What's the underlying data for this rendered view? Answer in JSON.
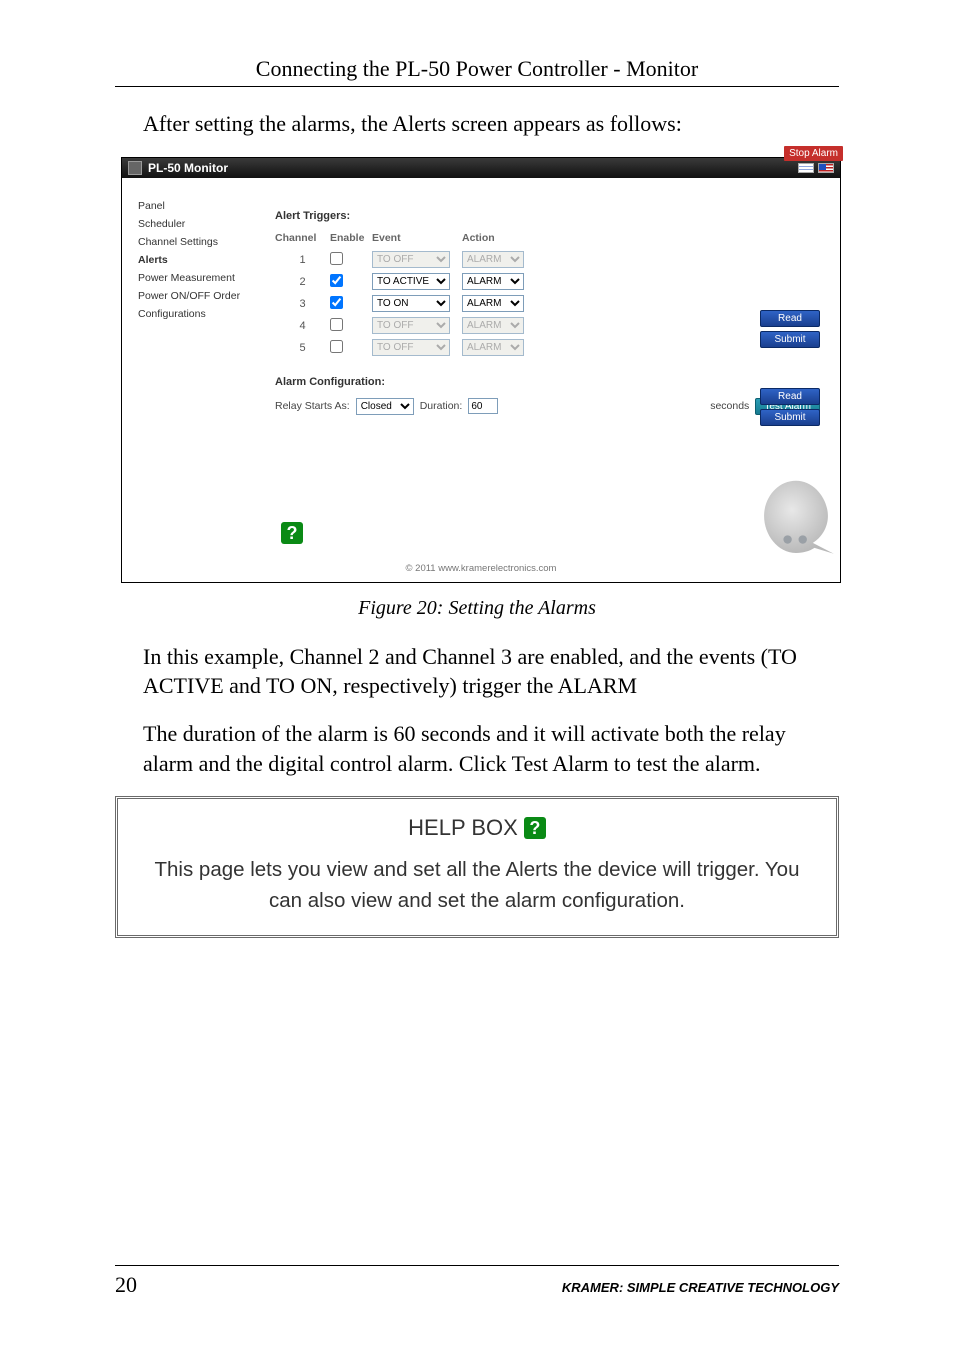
{
  "header": "Connecting the PL-50 Power Controller - Monitor",
  "intro": "After setting the alarms, the Alerts screen appears as follows:",
  "caption": "Figure 20: Setting the Alarms",
  "para1": "In this example, Channel 2 and Channel 3 are enabled, and the events (TO ACTIVE and TO ON, respectively) trigger the ALARM",
  "para2": "The duration of the alarm is 60 seconds and it will activate both the relay alarm and the digital control alarm. Click Test Alarm to test the alarm.",
  "helpbox": {
    "title": "HELP BOX",
    "body": "This page lets you view and set all the Alerts the device will trigger. You can also view and set the alarm configuration."
  },
  "footer": {
    "page": "20",
    "brand": "KRAMER:  SIMPLE CREATIVE TECHNOLOGY"
  },
  "app": {
    "stop_alarm": "Stop Alarm",
    "title": "PL-50 Monitor",
    "nav": {
      "panel": "Panel",
      "scheduler": "Scheduler",
      "channel_settings": "Channel Settings",
      "alerts": "Alerts",
      "power_meas": "Power Measurement",
      "power_order": "Power ON/OFF Order",
      "configs": "Configurations"
    },
    "section_triggers": "Alert Triggers:",
    "cols": {
      "channel": "Channel",
      "enable": "Enable",
      "event": "Event",
      "action": "Action"
    },
    "chart_data": {
      "type": "table",
      "columns": [
        "Channel",
        "Enable",
        "Event",
        "Action"
      ],
      "rows": [
        {
          "channel": "1",
          "enable": false,
          "event": "TO OFF",
          "action": "ALARM"
        },
        {
          "channel": "2",
          "enable": true,
          "event": "TO ACTIVE",
          "action": "ALARM"
        },
        {
          "channel": "3",
          "enable": true,
          "event": "TO ON",
          "action": "ALARM"
        },
        {
          "channel": "4",
          "enable": false,
          "event": "TO OFF",
          "action": "ALARM"
        },
        {
          "channel": "5",
          "enable": false,
          "event": "TO OFF",
          "action": "ALARM"
        }
      ]
    },
    "buttons": {
      "read": "Read",
      "submit": "Submit",
      "test_alarm": "Test Alarm"
    },
    "section_alarm_cfg": "Alarm Configuration:",
    "cfg": {
      "relay_label": "Relay Starts As:",
      "relay_value": "Closed",
      "duration_label": "Duration:",
      "duration_value": "60",
      "seconds": "seconds"
    },
    "footer": "© 2011 www.kramerelectronics.com"
  }
}
